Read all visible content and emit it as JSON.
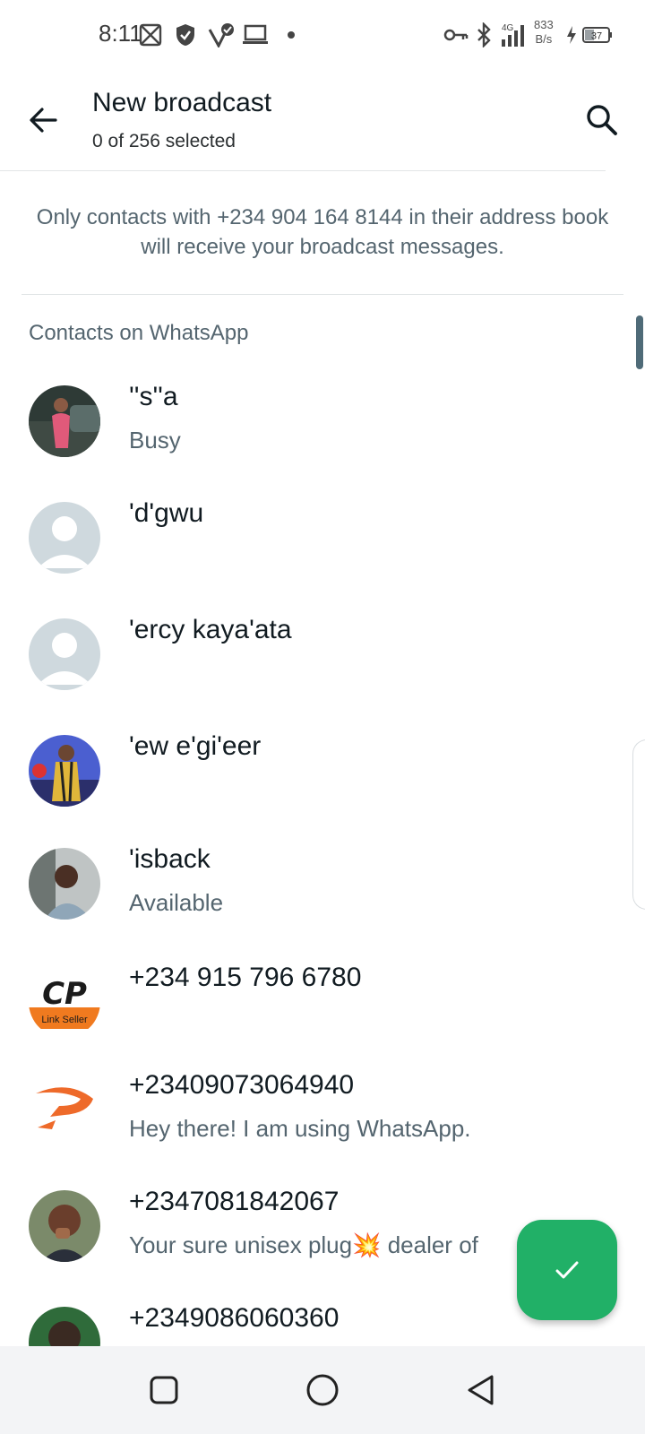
{
  "status_bar": {
    "time": "8:11",
    "net_speed": "833",
    "net_unit": "B/s",
    "network_type": "4G",
    "battery": "37",
    "icons": [
      "gallery-icon",
      "shield-icon",
      "check-badge-icon",
      "laptop-icon",
      "dot-icon",
      "key-icon",
      "bluetooth-icon",
      "signal-icon",
      "charging-icon",
      "battery-icon"
    ]
  },
  "app_bar": {
    "title": "New broadcast",
    "subtitle": "0 of 256 selected"
  },
  "notice": "Only contacts with +234 904 164 8144 in their address book will receive your broadcast messages.",
  "section_header": "Contacts on WhatsApp",
  "contacts": [
    {
      "name": "''s''a",
      "status": "Busy",
      "avatar": "photo"
    },
    {
      "name": "'d'gwu",
      "status": "",
      "avatar": "default"
    },
    {
      "name": "'ercy kaya'ata",
      "status": "",
      "avatar": "default"
    },
    {
      "name": "'ew e'gi'eer",
      "status": "",
      "avatar": "photo"
    },
    {
      "name": "'isback",
      "status": "Available",
      "avatar": "photo"
    },
    {
      "name": "+234 915 796 6780",
      "status": "",
      "avatar": "logo-cp"
    },
    {
      "name": "+23409073064940",
      "status": "Hey there! I am using WhatsApp.",
      "avatar": "logo-orange"
    },
    {
      "name": "+2347081842067",
      "status": "Your sure unisex plug💥 dealer of",
      "avatar": "photo"
    },
    {
      "name": "+2349086060360",
      "status": "",
      "avatar": "photo"
    }
  ],
  "cp_logo": {
    "letters": "CP",
    "caption": "Link Seller"
  },
  "colors": {
    "accent": "#21b067",
    "text_primary": "#111b21",
    "text_secondary": "#54656f"
  }
}
